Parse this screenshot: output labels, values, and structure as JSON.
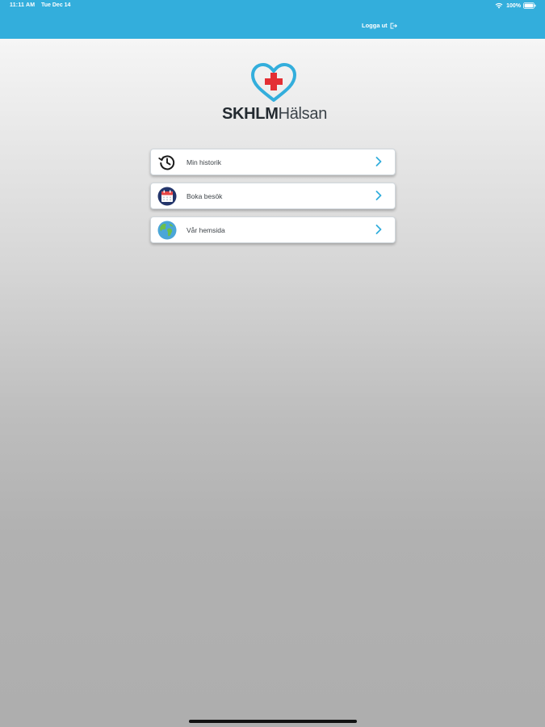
{
  "status_bar": {
    "time": "11:11 AM",
    "date": "Tue Dec 14",
    "battery": "100%"
  },
  "header": {
    "logout_label": "Logga ut"
  },
  "logo": {
    "brand_bold": "SKHLM",
    "brand_light": "Hälsan"
  },
  "menu": {
    "items": [
      {
        "label": "Min historik",
        "icon": "history-clock-icon"
      },
      {
        "label": "Boka besök",
        "icon": "calendar-icon"
      },
      {
        "label": "Vår hemsida",
        "icon": "globe-icon"
      }
    ]
  },
  "colors": {
    "topbar": "#33aedc",
    "accent": "#33aedc",
    "cross": "#e32f34"
  }
}
